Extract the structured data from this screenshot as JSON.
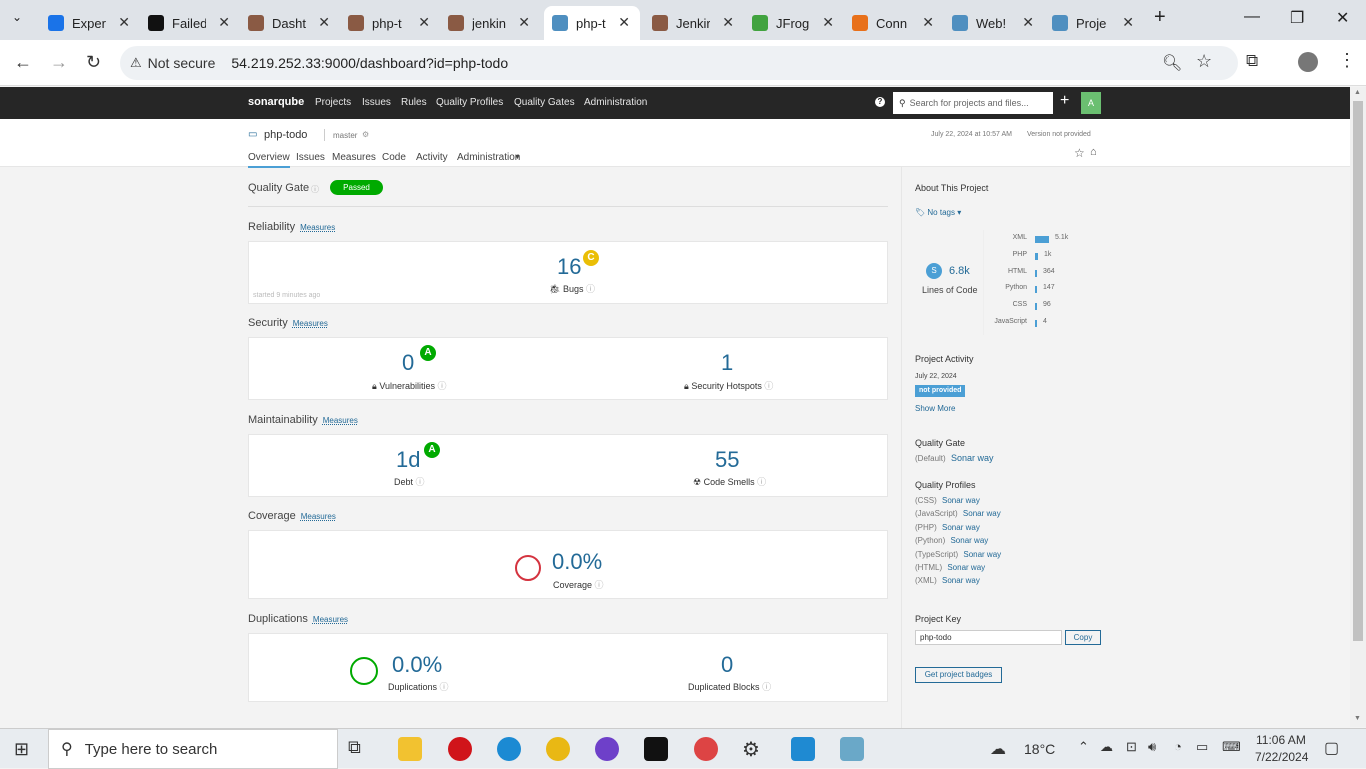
{
  "browser": {
    "tabs": [
      {
        "title": "Exper",
        "color": "#1a73e8"
      },
      {
        "title": "Failed",
        "color": "#111"
      },
      {
        "title": "Dasht",
        "color": "#8a5a44"
      },
      {
        "title": "php-t",
        "color": "#8a5a44"
      },
      {
        "title": "jenkin",
        "color": "#8a5a44"
      },
      {
        "title": "php-t",
        "color": "#4f8fc0"
      },
      {
        "title": "Jenkir",
        "color": "#8a5a44"
      },
      {
        "title": "JFrog",
        "color": "#41a33f"
      },
      {
        "title": "Conn",
        "color": "#e8701a"
      },
      {
        "title": "Web!",
        "color": "#4f8fc0"
      },
      {
        "title": "Proje",
        "color": "#4f8fc0"
      }
    ],
    "security": "Not secure",
    "url": "54.219.252.33:9000/dashboard?id=php-todo"
  },
  "sonar": {
    "logo": "sonarqube",
    "nav": [
      "Projects",
      "Issues",
      "Rules",
      "Quality Profiles",
      "Quality Gates",
      "Administration"
    ],
    "search_placeholder": "Search for projects and files...",
    "avatar": "A",
    "project": "php-todo",
    "branch": "master",
    "date": "July 22, 2024 at 10:57 AM",
    "version": "Version not provided",
    "tabs": [
      "Overview",
      "Issues",
      "Measures",
      "Code",
      "Activity",
      "Administration"
    ]
  },
  "main": {
    "quality_gate_label": "Quality Gate",
    "quality_gate_status": "Passed",
    "measures_link": "Measures",
    "reliability": {
      "title": "Reliability",
      "bugs": "16",
      "rating": "C",
      "bugs_label": "Bugs",
      "started": "started 9 minutes ago"
    },
    "security": {
      "title": "Security",
      "vulns": "0",
      "rating": "A",
      "vulns_label": "Vulnerabilities",
      "hotspots": "1",
      "hotspots_label": "Security Hotspots"
    },
    "maintainability": {
      "title": "Maintainability",
      "debt": "1d",
      "rating": "A",
      "debt_label": "Debt",
      "smells": "55",
      "smells_label": "Code Smells"
    },
    "coverage": {
      "title": "Coverage",
      "value": "0.0%",
      "label": "Coverage"
    },
    "duplications": {
      "title": "Duplications",
      "value": "0.0%",
      "label": "Duplications",
      "blocks": "0",
      "blocks_label": "Duplicated Blocks"
    }
  },
  "sidebar": {
    "about": "About This Project",
    "tags": "No tags",
    "size_badge": "S",
    "loc": "6.8k",
    "loc_label": "Lines of Code",
    "languages": [
      {
        "name": "XML",
        "value": "5.1k",
        "frac": 1.0
      },
      {
        "name": "PHP",
        "value": "1k",
        "frac": 0.2
      },
      {
        "name": "HTML",
        "value": "364",
        "frac": 0.07
      },
      {
        "name": "Python",
        "value": "147",
        "frac": 0.03
      },
      {
        "name": "CSS",
        "value": "96",
        "frac": 0.02
      },
      {
        "name": "JavaScript",
        "value": "4",
        "frac": 0.01
      }
    ],
    "activity": "Project Activity",
    "activity_date": "July 22, 2024",
    "activity_badge": "not provided",
    "show_more": "Show More",
    "qg_title": "Quality Gate",
    "qg_default": "(Default)",
    "qg_name": "Sonar way",
    "qp_title": "Quality Profiles",
    "profiles": [
      {
        "lang": "(CSS)",
        "name": "Sonar way"
      },
      {
        "lang": "(JavaScript)",
        "name": "Sonar way"
      },
      {
        "lang": "(PHP)",
        "name": "Sonar way"
      },
      {
        "lang": "(Python)",
        "name": "Sonar way"
      },
      {
        "lang": "(TypeScript)",
        "name": "Sonar way"
      },
      {
        "lang": "(HTML)",
        "name": "Sonar way"
      },
      {
        "lang": "(XML)",
        "name": "Sonar way"
      }
    ],
    "key_title": "Project Key",
    "key_value": "php-todo",
    "copy": "Copy",
    "badges": "Get project badges"
  },
  "taskbar": {
    "search": "Type here to search",
    "weather": "18°C",
    "time": "11:06 AM",
    "date": "7/22/2024"
  }
}
